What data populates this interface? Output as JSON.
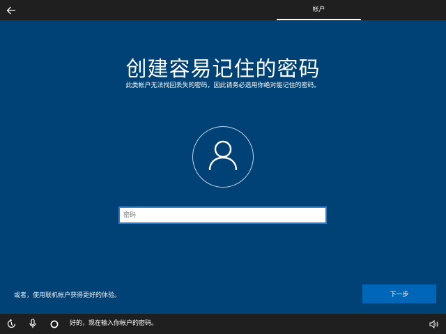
{
  "header": {
    "tab_label": "帐户"
  },
  "main": {
    "title": "创建容易记住的密码",
    "subtitle": "此类帐户无法找回丢失的密码，因此请务必选用你绝对能记住的密码。",
    "password_placeholder": "密码",
    "password_value": ""
  },
  "footer": {
    "online_link": "或者，使用联机帐户获得更好的体验。",
    "next_label": "下一步"
  },
  "taskbar": {
    "cortana_text": "好的，现在输入你帐户的密码。"
  },
  "icons": {
    "back": "back-arrow-icon",
    "user": "user-icon",
    "accessibility": "ease-of-access-icon",
    "microphone": "microphone-icon",
    "cortana": "cortana-icon",
    "volume": "volume-icon"
  },
  "colors": {
    "background": "#004275",
    "bars": "#1f1f1f",
    "accent": "#0067b8",
    "input_border": "#2b7bc5"
  }
}
